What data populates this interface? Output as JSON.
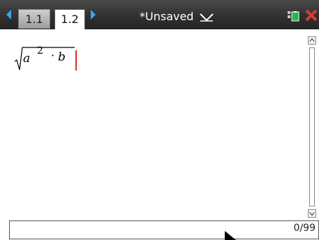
{
  "tabs": [
    {
      "label": "1.1",
      "active": false
    },
    {
      "label": "1.2",
      "active": true
    }
  ],
  "document": {
    "title": "*Unsaved"
  },
  "expression": {
    "base": "a",
    "exponent": "2",
    "operator": "·",
    "factor": "b"
  },
  "entry_line": {
    "char_count": "0/99"
  },
  "icons": {
    "tab_prev": "triangle-left-icon",
    "tab_next": "triangle-right-icon",
    "title_menu": "chevron-down-icon",
    "battery": "battery-icon",
    "close": "close-icon",
    "scroll_up": "scroll-up-icon",
    "scroll_down": "scroll-down-icon"
  },
  "colors": {
    "accent_blue": "#3aa7e8",
    "topbar": "#2f2f2f",
    "cursor_red": "#e02828",
    "battery_green": "#2fb34a",
    "close_red": "#d83a3a"
  }
}
